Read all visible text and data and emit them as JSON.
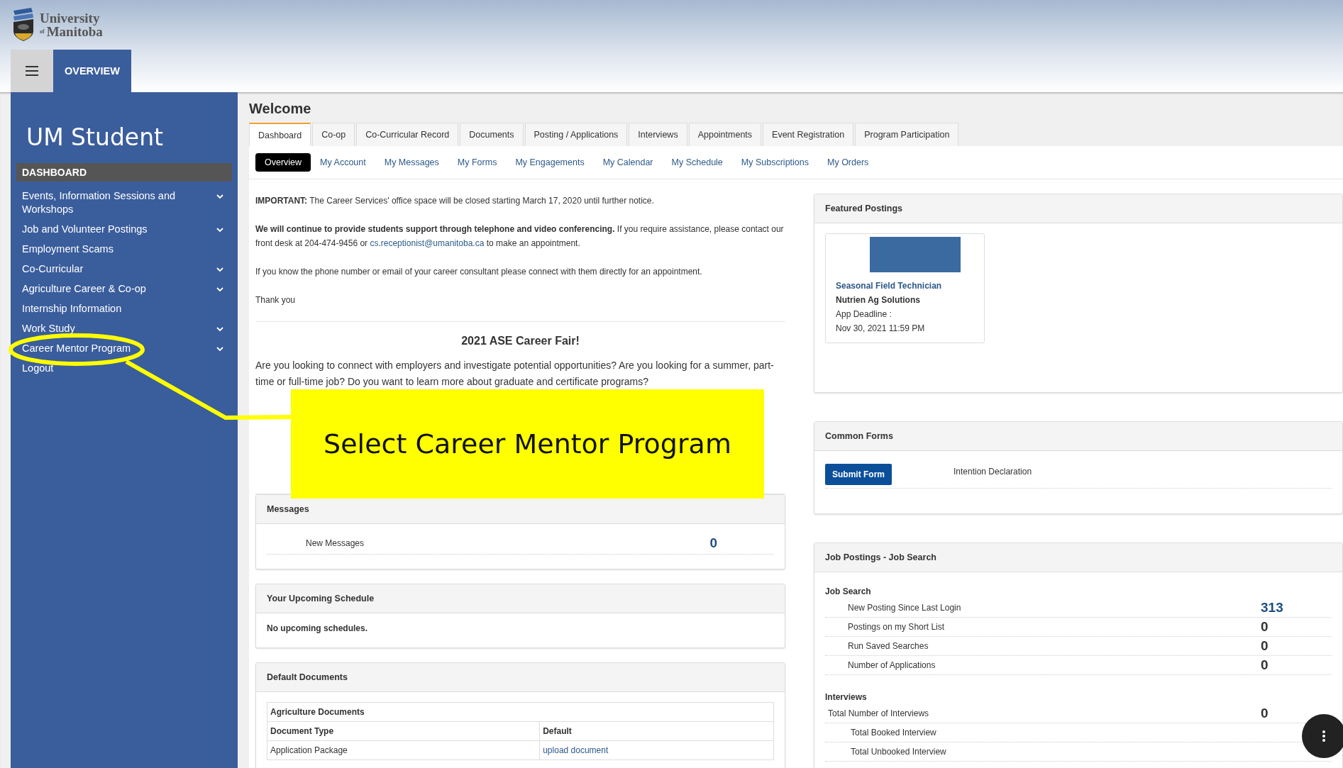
{
  "logo": {
    "line1": "University",
    "small": "of",
    "line2": "Manitoba"
  },
  "nav": {
    "tabs": [
      {
        "label": "OVERVIEW",
        "selected": true
      }
    ]
  },
  "sidebar": {
    "title": "UM Student",
    "items": [
      {
        "label": "DASHBOARD",
        "kind": "heading",
        "submenu": false
      },
      {
        "label": "Events, Information Sessions and Workshops",
        "kind": "link",
        "submenu": true
      },
      {
        "label": "Job and Volunteer Postings",
        "kind": "link",
        "submenu": true
      },
      {
        "label": "Employment Scams",
        "kind": "link",
        "submenu": false
      },
      {
        "label": "Co-Curricular",
        "kind": "link",
        "submenu": true
      },
      {
        "label": "Agriculture Career & Co-op",
        "kind": "link",
        "submenu": true
      },
      {
        "label": "Internship Information",
        "kind": "link",
        "submenu": false
      },
      {
        "label": "Work Study",
        "kind": "link",
        "submenu": true
      },
      {
        "label": "Career Mentor Program",
        "kind": "link",
        "submenu": true
      },
      {
        "label": "Logout",
        "kind": "link",
        "submenu": false
      }
    ]
  },
  "page": {
    "title": "Welcome",
    "tabs": [
      {
        "label": "Dashboard",
        "selected": true
      },
      {
        "label": "Co-op",
        "selected": false
      },
      {
        "label": "Co-Curricular Record",
        "selected": false
      },
      {
        "label": "Documents",
        "selected": false
      },
      {
        "label": "Posting / Applications",
        "selected": false
      },
      {
        "label": "Interviews",
        "selected": false
      },
      {
        "label": "Appointments",
        "selected": false
      },
      {
        "label": "Event Registration",
        "selected": false
      },
      {
        "label": "Program Participation",
        "selected": false
      }
    ],
    "subtabs": [
      {
        "label": "Overview",
        "selected": true
      },
      {
        "label": "My Account",
        "selected": false
      },
      {
        "label": "My Messages",
        "selected": false
      },
      {
        "label": "My Forms",
        "selected": false
      },
      {
        "label": "My Engagements",
        "selected": false
      },
      {
        "label": "My Calendar",
        "selected": false
      },
      {
        "label": "My Schedule",
        "selected": false
      },
      {
        "label": "My Subscriptions",
        "selected": false
      },
      {
        "label": "My Orders",
        "selected": false
      }
    ]
  },
  "notice": {
    "important": "**IMPORTANT:**  The Career Services' office space will be closed starting March 17, 2020 until further notice.",
    "contact_before": "**We will continue to provide students support through telephone and video conferencing.** If you require assistance, please contact our front desk at 204-474-9456 or ",
    "contact_link": "cs.receptionist@umanitoba.ca",
    "contact_after": " to make an appointment.",
    "consultant": "If you know the phone number or email of your career consultant please connect with them directly for an appointment.",
    "thanks": "Thank you"
  },
  "fair": {
    "heading": "2021 ASE Career Fair!",
    "text": "Are you looking to connect with employers and investigate potential opportunities? Are you looking for a summer, part-time or full-time job? Do you want to learn more about graduate and certificate programs?"
  },
  "messages": {
    "title": "Messages",
    "rows": [
      {
        "label": "New Messages",
        "value": "0"
      }
    ]
  },
  "schedule": {
    "title": "Your Upcoming Schedule",
    "empty": "No upcoming schedules."
  },
  "documents": {
    "title": "Default Documents",
    "caption": "Agriculture Documents",
    "columns": [
      "Document Type",
      "Default"
    ],
    "rows": [
      [
        "Application Package",
        "upload document"
      ]
    ]
  },
  "featured": {
    "title": "Featured Postings",
    "postings": [
      {
        "title": "Seasonal Field Technician",
        "company": "Nutrien Ag Solutions",
        "deadline_label": "App Deadline :",
        "deadline": "Nov 30, 2021 11:59 PM"
      }
    ]
  },
  "common_forms": {
    "title": "Common Forms",
    "forms": [
      {
        "button": "Submit Form",
        "name": "Intention Declaration"
      }
    ]
  },
  "job_postings": {
    "title": "Job Postings - Job Search",
    "groups": [
      {
        "title": "Job Search",
        "rows": [
          {
            "label": "New Posting Since Last Login",
            "value": "313",
            "kind": "stat",
            "link": true
          },
          {
            "label": "Postings on my Short List",
            "value": "0",
            "kind": "stat",
            "link": false
          },
          {
            "label": "Run Saved Searches",
            "value": "0",
            "kind": "stat",
            "link": false
          },
          {
            "label": "Number of Applications",
            "value": "0",
            "kind": "stat",
            "link": false
          }
        ]
      },
      {
        "title": "Interviews",
        "rows": [
          {
            "label": "Total Number of Interviews",
            "value": "0",
            "kind": "total",
            "link": false,
            "children": [
              {
                "label": "Total Booked Interview"
              },
              {
                "label": "Total Unbooked Interview"
              }
            ]
          }
        ]
      }
    ]
  },
  "annotation": {
    "text": "Select Career Mentor Program"
  }
}
